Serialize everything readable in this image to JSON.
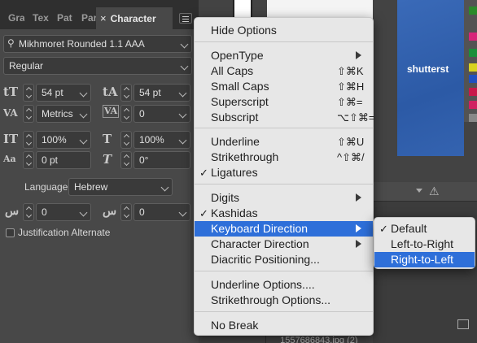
{
  "panel": {
    "tabs": [
      "Gra",
      "Tex",
      "Pat",
      "Par",
      "Character"
    ],
    "close_glyph": "×",
    "font_family": "Mikhmoret Rounded 1.1 AAA",
    "font_style": "Regular",
    "font_size": "54 pt",
    "leading": "54 pt",
    "kerning": "Metrics",
    "tracking": "0",
    "vertical_scale": "100%",
    "horizontal_scale": "100%",
    "baseline_shift": "0 pt",
    "rotation": "0°",
    "language_label": "Language:",
    "language": "Hebrew",
    "diacritic_x": "0",
    "diacritic_y": "0",
    "justification_alternate": "Justification Alternate",
    "icons": {
      "font_size": "tT",
      "leading": "tA",
      "kerning": "VA",
      "tracking": "VA",
      "vscale": "IT",
      "hscale": "T",
      "baseline": "Aa",
      "rotation": "T",
      "diac_x": "س",
      "diac_y": "س"
    }
  },
  "background": {
    "watermark": "shutterst",
    "filename": "_1557686843.jpg (2)",
    "warning_glyph": "⚠",
    "swatch_colors": [
      "#2a8a2a",
      "#d8257a",
      "#1a8f3a",
      "#d8d220",
      "#2050c0",
      "#c8184a",
      "#d02060",
      "#888888"
    ]
  },
  "menu": {
    "items": [
      {
        "label": "Hide Options"
      },
      {
        "label": "OpenType",
        "submenu": true
      },
      {
        "label": "All Caps",
        "shortcut": "⇧⌘K"
      },
      {
        "label": "Small Caps",
        "shortcut": "⇧⌘H"
      },
      {
        "label": "Superscript",
        "shortcut": "⇧⌘="
      },
      {
        "label": "Subscript",
        "shortcut": "⌥⇧⌘="
      },
      {
        "label": "Underline",
        "shortcut": "⇧⌘U"
      },
      {
        "label": "Strikethrough",
        "shortcut": "^⇧⌘/"
      },
      {
        "label": "Ligatures",
        "checked": true
      },
      {
        "label": "Digits",
        "submenu": true
      },
      {
        "label": "Kashidas",
        "checked": true
      },
      {
        "label": "Keyboard Direction",
        "submenu": true,
        "highlighted": true
      },
      {
        "label": "Character Direction",
        "submenu": true
      },
      {
        "label": "Diacritic Positioning..."
      },
      {
        "label": "Underline Options...."
      },
      {
        "label": "Strikethrough Options..."
      },
      {
        "label": "No Break"
      }
    ],
    "check_glyph": "✓"
  },
  "submenu": {
    "items": [
      {
        "label": "Default",
        "checked": true
      },
      {
        "label": "Left-to-Right"
      },
      {
        "label": "Right-to-Left",
        "highlighted": true
      }
    ]
  },
  "colors": {
    "highlight": "#2e6fd9",
    "menu_bg": "#e7e7e7",
    "panel_bg": "#484848"
  }
}
